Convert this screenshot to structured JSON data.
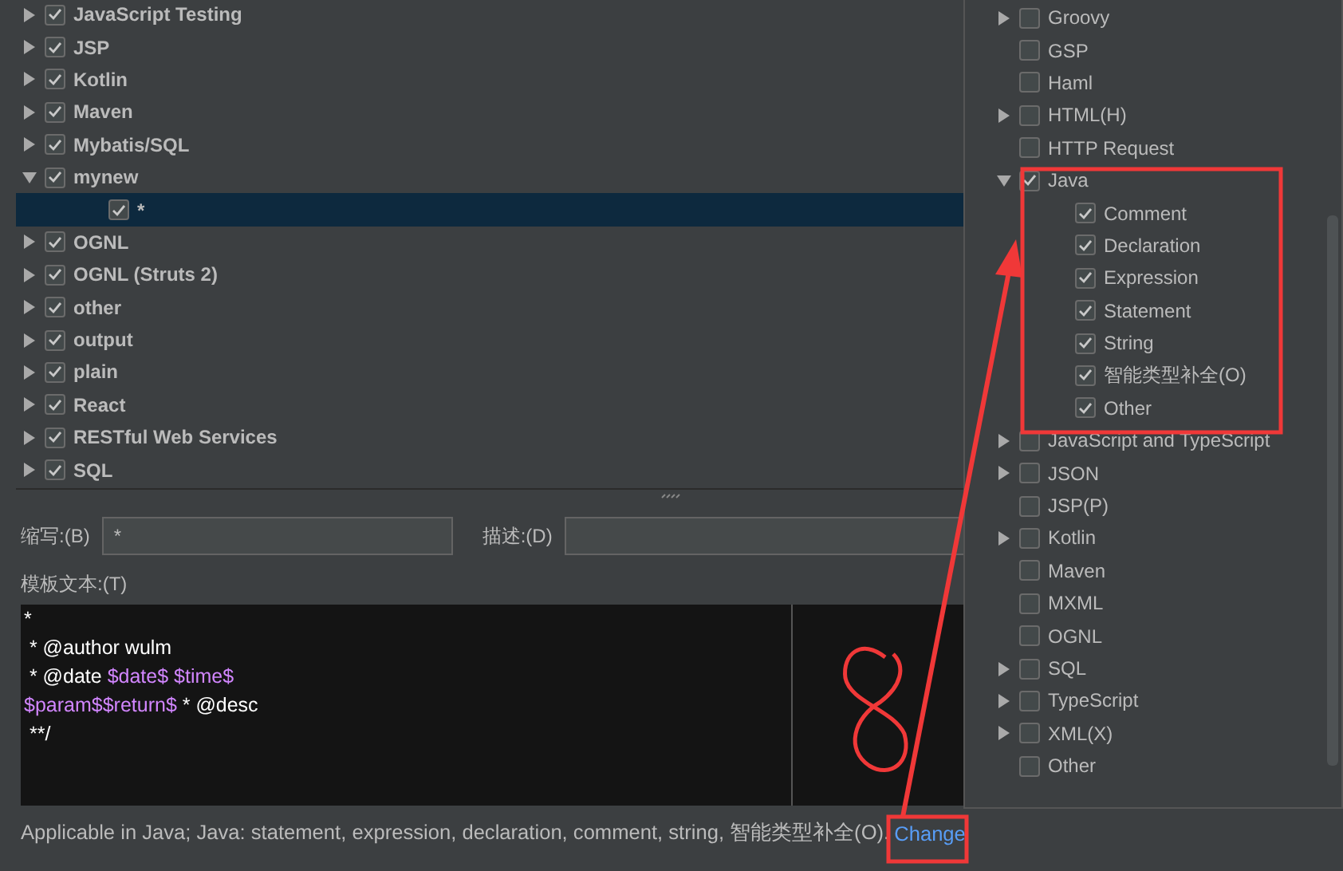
{
  "tree": {
    "items": [
      {
        "label": "JavaScript Testing",
        "expanded": false,
        "checked": true,
        "selected": false
      },
      {
        "label": "JSP",
        "expanded": false,
        "checked": true,
        "selected": false
      },
      {
        "label": "Kotlin",
        "expanded": false,
        "checked": true,
        "selected": false
      },
      {
        "label": "Maven",
        "expanded": false,
        "checked": true,
        "selected": false
      },
      {
        "label": "Mybatis/SQL",
        "expanded": false,
        "checked": true,
        "selected": false
      },
      {
        "label": "mynew",
        "expanded": true,
        "checked": true,
        "selected": false,
        "children": [
          {
            "label": "*",
            "checked": true,
            "selected": true
          }
        ]
      },
      {
        "label": "OGNL",
        "expanded": false,
        "checked": true,
        "selected": false
      },
      {
        "label": "OGNL (Struts 2)",
        "expanded": false,
        "checked": true,
        "selected": false
      },
      {
        "label": "other",
        "expanded": false,
        "checked": true,
        "selected": false
      },
      {
        "label": "output",
        "expanded": false,
        "checked": true,
        "selected": false
      },
      {
        "label": "plain",
        "expanded": false,
        "checked": true,
        "selected": false
      },
      {
        "label": "React",
        "expanded": false,
        "checked": true,
        "selected": false
      },
      {
        "label": "RESTful Web Services",
        "expanded": false,
        "checked": true,
        "selected": false
      },
      {
        "label": "SQL",
        "expanded": false,
        "checked": true,
        "selected": false
      }
    ]
  },
  "abbreviation": {
    "label": "缩写:(B)",
    "value": "*"
  },
  "description": {
    "label": "描述:(D)"
  },
  "template": {
    "label": "模板文本:(T)",
    "lines": [
      [
        {
          "text": "*",
          "kind": "plain"
        }
      ],
      [
        {
          "text": " * @author wulm",
          "kind": "plain"
        }
      ],
      [
        {
          "text": " * @date ",
          "kind": "plain"
        },
        {
          "text": "$date$ $time$",
          "kind": "variable"
        }
      ],
      [
        {
          "text": "$param$$return$",
          "kind": "variable"
        },
        {
          "text": " * @desc",
          "kind": "plain"
        }
      ],
      [
        {
          "text": " **/",
          "kind": "plain"
        }
      ]
    ]
  },
  "footer": {
    "text": "Applicable in Java; Java: statement, expression, declaration, comment, string, 智能类型补全(O).",
    "link": "Change"
  },
  "contexts": {
    "items": [
      {
        "label": "Groovy",
        "expanded": false,
        "checked": false
      },
      {
        "label": "GSP",
        "checked": false
      },
      {
        "label": "Haml",
        "checked": false
      },
      {
        "label": "HTML(H)",
        "expanded": false,
        "checked": false
      },
      {
        "label": "HTTP Request",
        "checked": false
      },
      {
        "label": "Java",
        "expanded": true,
        "checked": true,
        "children": [
          {
            "label": "Comment",
            "checked": true
          },
          {
            "label": "Declaration",
            "checked": true
          },
          {
            "label": "Expression",
            "checked": true
          },
          {
            "label": "Statement",
            "checked": true
          },
          {
            "label": "String",
            "checked": true
          },
          {
            "label": "智能类型补全(O)",
            "checked": true
          },
          {
            "label": "Other",
            "checked": true
          }
        ]
      },
      {
        "label": "JavaScript and TypeScript",
        "expanded": false,
        "checked": false
      },
      {
        "label": "JSON",
        "expanded": false,
        "checked": false
      },
      {
        "label": "JSP(P)",
        "checked": false
      },
      {
        "label": "Kotlin",
        "expanded": false,
        "checked": false
      },
      {
        "label": "Maven",
        "checked": false
      },
      {
        "label": "MXML",
        "checked": false
      },
      {
        "label": "OGNL",
        "checked": false
      },
      {
        "label": "SQL",
        "expanded": false,
        "checked": false
      },
      {
        "label": "TypeScript",
        "expanded": false,
        "checked": false
      },
      {
        "label": "XML(X)",
        "expanded": false,
        "checked": false
      },
      {
        "label": "Other",
        "checked": false
      }
    ]
  }
}
